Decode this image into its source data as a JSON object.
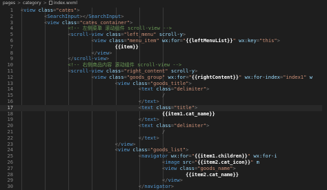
{
  "breadcrumb": {
    "items": [
      "pages",
      "category",
      "index.wxml"
    ],
    "separator": ">"
  },
  "editor": {
    "lines": [
      {
        "n": "1",
        "indent": 0,
        "tokens": [
          [
            "p",
            "<"
          ],
          [
            "t",
            "view"
          ],
          [
            "a",
            " class"
          ],
          [
            "p",
            "="
          ],
          [
            "s",
            "\"cates\""
          ],
          [
            "p",
            ">"
          ]
        ]
      },
      {
        "n": "2",
        "indent": 8,
        "tokens": [
          [
            "p",
            "<"
          ],
          [
            "t",
            "SearchInput"
          ],
          [
            "p",
            "></"
          ],
          [
            "t",
            "SearchInput"
          ],
          [
            "p",
            ">"
          ]
        ]
      },
      {
        "n": "3",
        "indent": 8,
        "tokens": [
          [
            "p",
            "<"
          ],
          [
            "t",
            "view"
          ],
          [
            "a",
            " class"
          ],
          [
            "p",
            "="
          ],
          [
            "s",
            "\"cates_container\""
          ],
          [
            "p",
            ">"
          ]
        ]
      },
      {
        "n": "4",
        "indent": 16,
        "tokens": [
          [
            "c",
            "<!-- 左侧菜单 滚动组件 scroll-view -->"
          ]
        ]
      },
      {
        "n": "5",
        "indent": 16,
        "tokens": [
          [
            "p",
            "<"
          ],
          [
            "t",
            "scroll-view"
          ],
          [
            "a",
            " class"
          ],
          [
            "p",
            "="
          ],
          [
            "s",
            "\"left_menu\""
          ],
          [
            "a",
            " scroll-y"
          ],
          [
            "p",
            ">"
          ]
        ]
      },
      {
        "n": "6",
        "indent": 24,
        "tokens": [
          [
            "p",
            "<"
          ],
          [
            "t",
            "view"
          ],
          [
            "a",
            " class"
          ],
          [
            "p",
            "="
          ],
          [
            "s",
            "\"menu_item\""
          ],
          [
            "a",
            " wx:for"
          ],
          [
            "p",
            "="
          ],
          [
            "s",
            "\""
          ],
          [
            "b",
            "{{leftMenuList}}"
          ],
          [
            "s",
            "\""
          ],
          [
            "a",
            " wx:key"
          ],
          [
            "p",
            "="
          ],
          [
            "s",
            "\"this\""
          ],
          [
            "p",
            ">"
          ]
        ]
      },
      {
        "n": "7",
        "indent": 32,
        "tokens": [
          [
            "b",
            "{{item}}"
          ]
        ]
      },
      {
        "n": "8",
        "indent": 24,
        "tokens": [
          [
            "p",
            "</"
          ],
          [
            "t",
            "view"
          ],
          [
            "p",
            ">"
          ]
        ]
      },
      {
        "n": "9",
        "indent": 16,
        "tokens": [
          [
            "p",
            "</"
          ],
          [
            "t",
            "scroll-view"
          ],
          [
            "p",
            ">"
          ]
        ]
      },
      {
        "n": "10",
        "indent": 16,
        "tokens": [
          [
            "c",
            "<!-- 右侧商品内容 滚动组件 scroll-view -->"
          ]
        ]
      },
      {
        "n": "11",
        "indent": 16,
        "tokens": [
          [
            "p",
            "<"
          ],
          [
            "t",
            "scroll-view"
          ],
          [
            "a",
            " class"
          ],
          [
            "p",
            "="
          ],
          [
            "s",
            "\"right_content\""
          ],
          [
            "a",
            " scroll-y"
          ],
          [
            "p",
            ">"
          ]
        ]
      },
      {
        "n": "12",
        "indent": 24,
        "tokens": [
          [
            "p",
            "<"
          ],
          [
            "t",
            "view"
          ],
          [
            "a",
            " class"
          ],
          [
            "p",
            "="
          ],
          [
            "s",
            "\"goods_group\""
          ],
          [
            "a",
            " wx:for"
          ],
          [
            "p",
            "="
          ],
          [
            "s",
            "\""
          ],
          [
            "b",
            "{{rightContent}}"
          ],
          [
            "s",
            "\""
          ],
          [
            "a",
            " wx:for-index"
          ],
          [
            "p",
            "="
          ],
          [
            "s",
            "\"index1\""
          ],
          [
            "a",
            " w"
          ]
        ]
      },
      {
        "n": "13",
        "indent": 32,
        "tokens": [
          [
            "p",
            "<"
          ],
          [
            "t",
            "view"
          ],
          [
            "a",
            " class"
          ],
          [
            "p",
            "="
          ],
          [
            "s",
            "\"goods_title\""
          ],
          [
            "p",
            ">"
          ]
        ]
      },
      {
        "n": "14",
        "indent": 40,
        "tokens": [
          [
            "p",
            "<"
          ],
          [
            "t",
            "text"
          ],
          [
            "a",
            " class"
          ],
          [
            "p",
            "="
          ],
          [
            "s",
            "\"delimiter\""
          ],
          [
            "p",
            ">"
          ]
        ]
      },
      {
        "n": "15",
        "indent": 48,
        "tokens": [
          [
            "p",
            "/"
          ]
        ]
      },
      {
        "n": "16",
        "indent": 40,
        "tokens": [
          [
            "p",
            "</"
          ],
          [
            "t",
            "text"
          ],
          [
            "p",
            ">"
          ]
        ]
      },
      {
        "n": "17",
        "indent": 40,
        "tokens": [
          [
            "p",
            "<"
          ],
          [
            "t",
            "text"
          ],
          [
            "a",
            " class"
          ],
          [
            "p",
            "="
          ],
          [
            "s",
            "\"title\""
          ],
          [
            "p",
            ">"
          ]
        ],
        "active": true
      },
      {
        "n": "18",
        "indent": 48,
        "tokens": [
          [
            "b",
            "{{item1.cat_name}}"
          ]
        ]
      },
      {
        "n": "19",
        "indent": 40,
        "tokens": [
          [
            "p",
            "</"
          ],
          [
            "t",
            "text"
          ],
          [
            "p",
            ">"
          ]
        ]
      },
      {
        "n": "20",
        "indent": 40,
        "tokens": [
          [
            "p",
            "<"
          ],
          [
            "t",
            "text"
          ],
          [
            "a",
            " class"
          ],
          [
            "p",
            "="
          ],
          [
            "s",
            "\"delimiter\""
          ],
          [
            "p",
            ">"
          ]
        ]
      },
      {
        "n": "21",
        "indent": 48,
        "tokens": [
          [
            "p",
            "/"
          ]
        ]
      },
      {
        "n": "22",
        "indent": 40,
        "tokens": [
          [
            "p",
            "</"
          ],
          [
            "t",
            "text"
          ],
          [
            "p",
            ">"
          ]
        ]
      },
      {
        "n": "23",
        "indent": 32,
        "tokens": [
          [
            "p",
            "</"
          ],
          [
            "t",
            "view"
          ],
          [
            "p",
            ">"
          ]
        ]
      },
      {
        "n": "24",
        "indent": 32,
        "tokens": [
          [
            "p",
            "<"
          ],
          [
            "t",
            "view"
          ],
          [
            "a",
            " class"
          ],
          [
            "p",
            "="
          ],
          [
            "s",
            "\"goods_list\""
          ],
          [
            "p",
            ">"
          ]
        ]
      },
      {
        "n": "25",
        "indent": 40,
        "tokens": [
          [
            "p",
            "<"
          ],
          [
            "t",
            "navigator"
          ],
          [
            "a",
            " wx:for"
          ],
          [
            "p",
            "="
          ],
          [
            "s",
            "\""
          ],
          [
            "b",
            "{{item1.children}}"
          ],
          [
            "s",
            "\""
          ],
          [
            "a",
            " wx:for-i"
          ]
        ]
      },
      {
        "n": "26",
        "indent": 48,
        "tokens": [
          [
            "p",
            "<"
          ],
          [
            "t",
            "image"
          ],
          [
            "a",
            " src"
          ],
          [
            "p",
            "="
          ],
          [
            "s",
            "\""
          ],
          [
            "b",
            "{{item2.cat_icon}}"
          ],
          [
            "s",
            "\""
          ],
          [
            "a",
            " m"
          ]
        ]
      },
      {
        "n": "27",
        "indent": 48,
        "tokens": [
          [
            "p",
            "<"
          ],
          [
            "t",
            "view"
          ],
          [
            "a",
            " class"
          ],
          [
            "p",
            "="
          ],
          [
            "s",
            "\"goods_name\""
          ],
          [
            "p",
            ">"
          ]
        ]
      },
      {
        "n": "28",
        "indent": 56,
        "tokens": [
          [
            "b",
            "{{item2.cat_name}}"
          ]
        ]
      },
      {
        "n": "29",
        "indent": 48,
        "tokens": [
          [
            "p",
            "</"
          ],
          [
            "t",
            "view"
          ],
          [
            "p",
            ">"
          ]
        ]
      },
      {
        "n": "30",
        "indent": 40,
        "tokens": [
          [
            "p",
            "</"
          ],
          [
            "t",
            "navigator"
          ],
          [
            "p",
            ">"
          ]
        ]
      }
    ]
  },
  "colors": {
    "background": "#1e1e1e",
    "tag": "#569cd6",
    "attribute": "#9cdcfe",
    "string": "#ce9178",
    "comment": "#6a9955",
    "line_number": "#858585"
  }
}
